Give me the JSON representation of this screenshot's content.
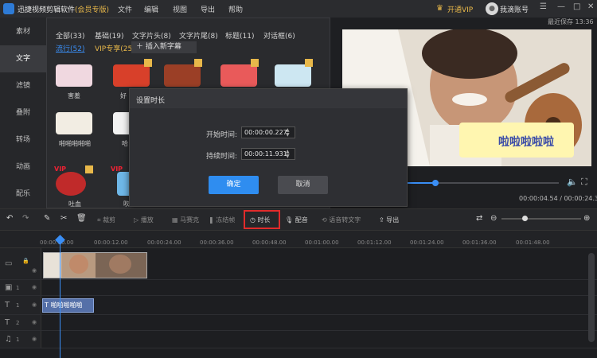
{
  "titlebar": {
    "app_name": "迅捷视频剪辑软件",
    "edition": "(会员专版)",
    "menu": [
      "文件",
      "编辑",
      "视图",
      "导出",
      "帮助"
    ],
    "vip_button": "开通VIP",
    "user_label": "我滴账号"
  },
  "sidebar": {
    "items": [
      {
        "label": "素材"
      },
      {
        "label": "文字",
        "active": true
      },
      {
        "label": "滤镜"
      },
      {
        "label": "叠附"
      },
      {
        "label": "转场"
      },
      {
        "label": "动画"
      },
      {
        "label": "配乐"
      }
    ]
  },
  "library": {
    "categories": [
      "全部(33)",
      "基础(19)",
      "文字片头(8)",
      "文字片尾(8)",
      "标题(11)",
      "对话框(6)"
    ],
    "subtabs": [
      "流行(52)",
      "VIP专享(25)"
    ],
    "insert_button": "插入新字幕",
    "items": [
      {
        "label": "害羞",
        "vip": false
      },
      {
        "label": "好",
        "vip": true
      },
      {
        "label": "啪啪啪啪啪",
        "vip": false
      },
      {
        "label": "哈",
        "vip": false
      },
      {
        "label": "吐血",
        "vip": true
      },
      {
        "label": "吹",
        "vip": true
      }
    ]
  },
  "preview": {
    "autosave_label": "最近保存 13:36",
    "subtitle_text": "啦啦啦啦啦",
    "current_time": "00:00:04.54",
    "total_time": "00:00:24.38",
    "progress_fraction": 0.186
  },
  "dialog": {
    "title": "设置时长",
    "start_label": "开始时间:",
    "start_value": "00:00:00.227",
    "duration_label": "持续时间:",
    "duration_value": "00:00:11.931",
    "ok_label": "确定",
    "cancel_label": "取消"
  },
  "toolbar": {
    "tools": [
      "裁剪",
      "播放",
      "马赛克",
      "冻结帧",
      "时长",
      "配音",
      "语音转文字",
      "导出"
    ]
  },
  "timeline": {
    "ticks": [
      "00:00:00.00",
      "00:00:12.00",
      "00:00:24.00",
      "00:00:36.00",
      "00:00:48.00",
      "00:01:00.00",
      "00:01:12.00",
      "00:01:24.00",
      "00:01:36.00",
      "00:01:48.00"
    ],
    "text_clip_label": "啪啪啪啪啪",
    "tracks": [
      "1",
      "1",
      "1",
      "2",
      "1"
    ]
  },
  "colors": {
    "accent": "#2f8df0",
    "vip": "#e8b84a",
    "highlight_box": "#e12b2b"
  }
}
